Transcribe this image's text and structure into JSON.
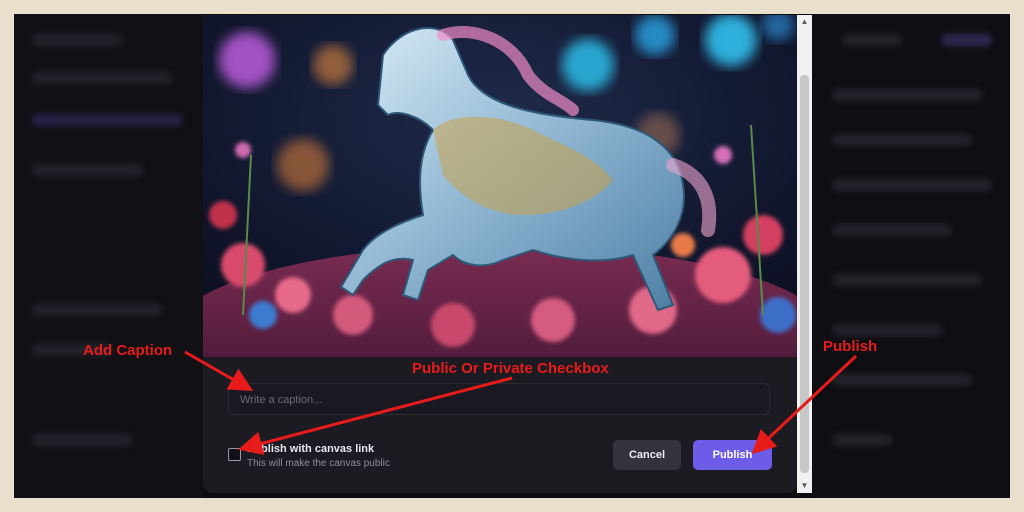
{
  "modal": {
    "caption_placeholder": "Write a caption...",
    "checkbox_title": "Publish with canvas link",
    "checkbox_subtitle": "This will make the canvas public",
    "cancel_label": "Cancel",
    "publish_label": "Publish",
    "accent_color": "#6c5ce7"
  },
  "annotations": {
    "add_caption": "Add Caption",
    "public_private": "Public Or Private Checkbox",
    "publish": "Publish",
    "color": "#e81b1b"
  },
  "icons": {
    "scroll_up": "scroll-up-arrow-icon",
    "scroll_down": "scroll-down-arrow-icon"
  }
}
